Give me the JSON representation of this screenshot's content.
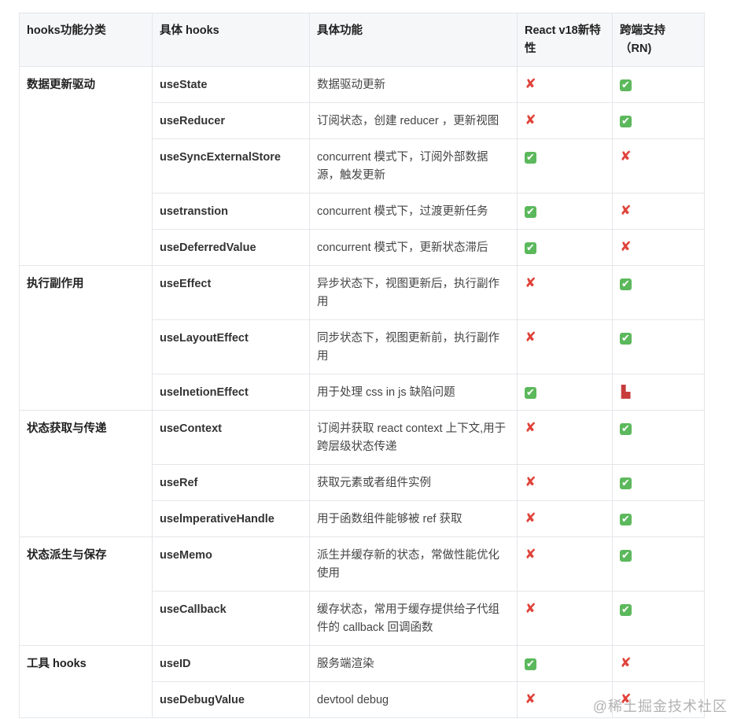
{
  "headers": [
    "hooks功能分类",
    "具体 hooks",
    "具体功能",
    "React v18新特性",
    "跨端支持（RN)"
  ],
  "groups": [
    {
      "category": "数据更新驱动",
      "rows": [
        {
          "hook": "useState",
          "desc": "数据驱动更新",
          "v18": "no",
          "rn": "yes"
        },
        {
          "hook": "useReducer",
          "desc": "订阅状态，创建 reducer ，更新视图",
          "v18": "no",
          "rn": "yes"
        },
        {
          "hook": "useSyncExternalStore",
          "desc": "concurrent 模式下，订阅外部数据源，触发更新",
          "v18": "yes",
          "rn": "no"
        },
        {
          "hook": "usetranstion",
          "desc": "concurrent 模式下，过渡更新任务",
          "v18": "yes",
          "rn": "no"
        },
        {
          "hook": "useDeferredValue",
          "desc": "concurrent 模式下，更新状态滞后",
          "v18": "yes",
          "rn": "no"
        }
      ]
    },
    {
      "category": "执行副作用",
      "rows": [
        {
          "hook": "useEffect",
          "desc": "异步状态下，视图更新后，执行副作用",
          "v18": "no",
          "rn": "yes"
        },
        {
          "hook": "useLayoutEffect",
          "desc": "同步状态下，视图更新前，执行副作用",
          "v18": "no",
          "rn": "yes"
        },
        {
          "hook": "uselnetionEffect",
          "desc": "用于处理  css in js 缺陷问题",
          "v18": "yes",
          "rn": "partial"
        }
      ]
    },
    {
      "category": "状态获取与传递",
      "rows": [
        {
          "hook": "useContext",
          "desc": "订阅并获取 react context 上下文,用于跨层级状态传递",
          "v18": "no",
          "rn": "yes"
        },
        {
          "hook": "useRef",
          "desc": "获取元素或者组件实例",
          "v18": "no",
          "rn": "yes"
        },
        {
          "hook": "uselmperativeHandle",
          "desc": "用于函数组件能够被 ref 获取",
          "v18": "no",
          "rn": "yes"
        }
      ]
    },
    {
      "category": "状态派生与保存",
      "rows": [
        {
          "hook": "useMemo",
          "desc": "派生并缓存新的状态，常做性能优化使用",
          "v18": "no",
          "rn": "yes"
        },
        {
          "hook": "useCallback",
          "desc": "缓存状态，常用于缓存提供给子代组件的 callback 回调函数",
          "v18": "no",
          "rn": "yes"
        }
      ]
    },
    {
      "category": "工具 hooks",
      "rows": [
        {
          "hook": "useID",
          "desc": "服务端渲染",
          "v18": "yes",
          "rn": "no"
        },
        {
          "hook": "useDebugValue",
          "desc": "devtool debug",
          "v18": "no",
          "rn": "no"
        }
      ]
    }
  ],
  "icons": {
    "yes": "✔",
    "no": "✘",
    "partial": "▙"
  },
  "colors": {
    "yes": "#5cb85c",
    "no": "#e0433a",
    "header_bg": "#f6f7f9",
    "border": "#e4e6ea"
  },
  "watermark": "@稀土掘金技术社区"
}
